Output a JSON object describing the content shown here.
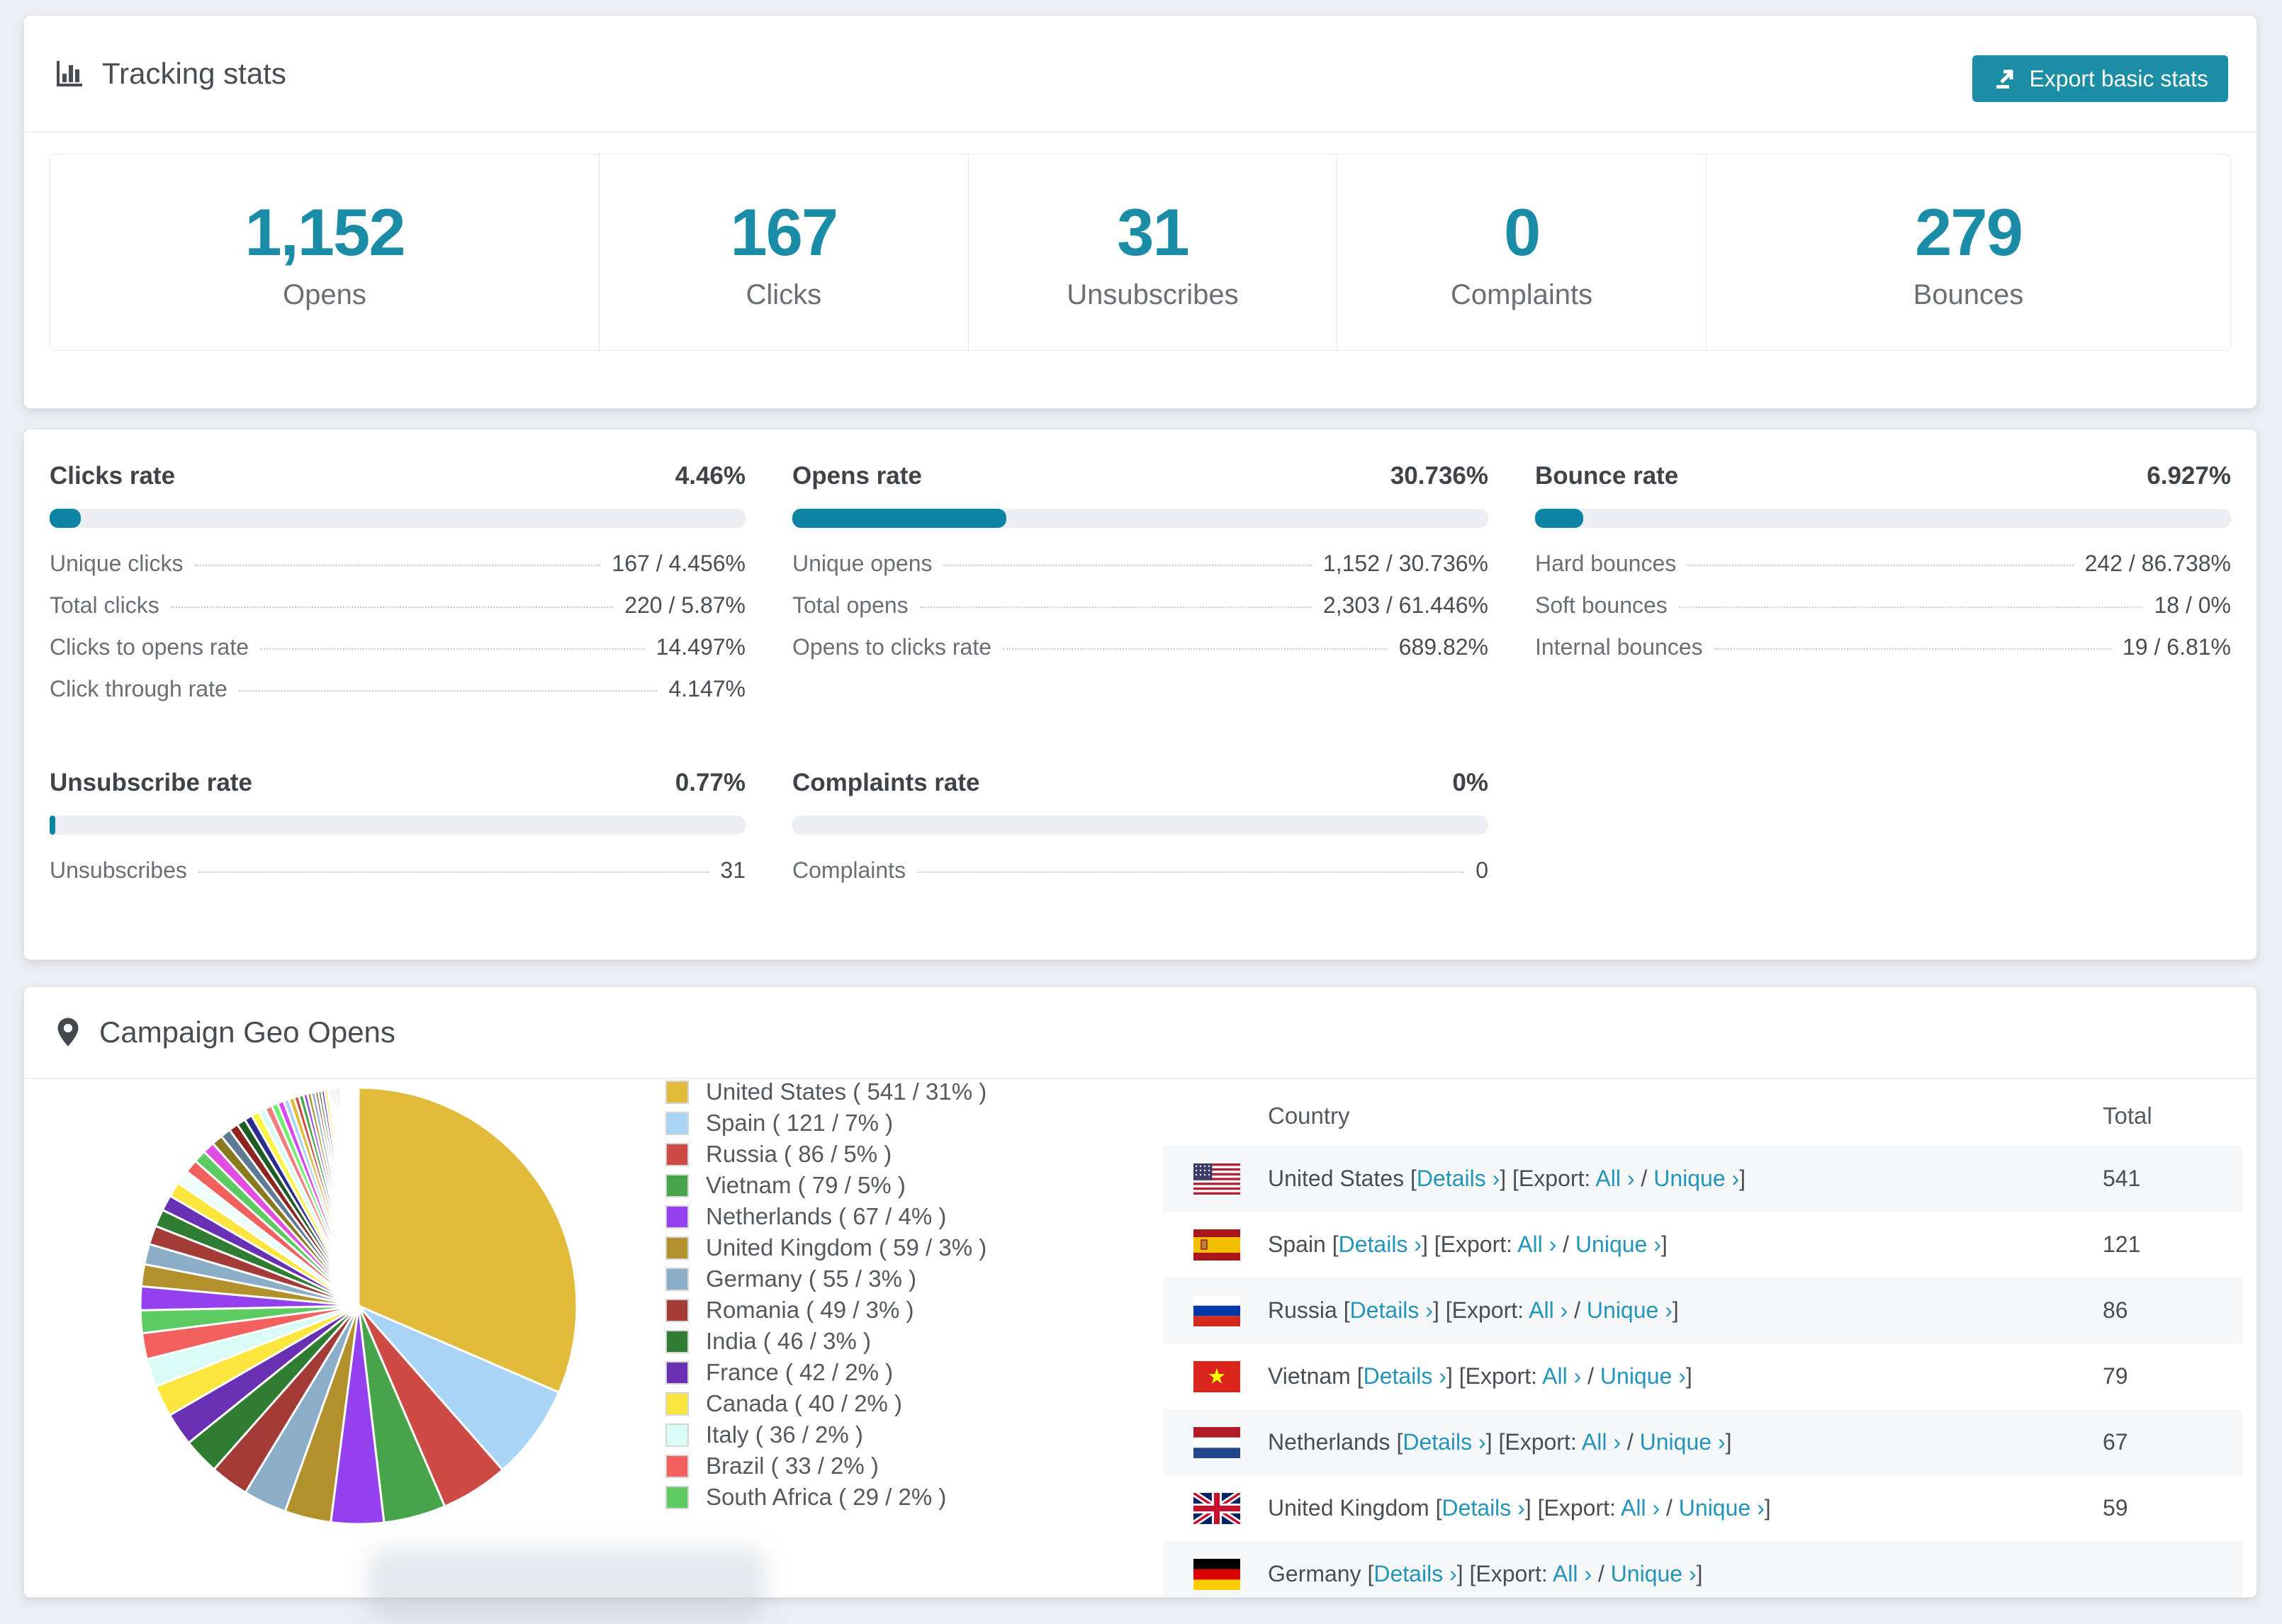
{
  "tracking": {
    "title": "Tracking stats",
    "export_button": "Export basic stats",
    "stats": [
      {
        "value": "1,152",
        "label": "Opens",
        "flex": 776
      },
      {
        "value": "167",
        "label": "Clicks",
        "flex": 521
      },
      {
        "value": "31",
        "label": "Unsubscribes",
        "flex": 521
      },
      {
        "value": "0",
        "label": "Complaints",
        "flex": 521
      },
      {
        "value": "279",
        "label": "Bounces",
        "flex": 741
      }
    ]
  },
  "rates": {
    "row1": [
      {
        "title": "Clicks rate",
        "value": "4.46%",
        "pct": 4.46,
        "rows": [
          [
            "Unique clicks",
            "167 / 4.456%"
          ],
          [
            "Total clicks",
            "220 / 5.87%"
          ],
          [
            "Clicks to opens rate",
            "14.497%"
          ],
          [
            "Click through rate",
            "4.147%"
          ]
        ]
      },
      {
        "title": "Opens rate",
        "value": "30.736%",
        "pct": 30.736,
        "rows": [
          [
            "Unique opens",
            "1,152 / 30.736%"
          ],
          [
            "Total opens",
            "2,303 / 61.446%"
          ],
          [
            "Opens to clicks rate",
            "689.82%"
          ]
        ]
      },
      {
        "title": "Bounce rate",
        "value": "6.927%",
        "pct": 6.927,
        "rows": [
          [
            "Hard bounces",
            "242 / 86.738%"
          ],
          [
            "Soft bounces",
            "18 / 0%"
          ],
          [
            "Internal bounces",
            "19 / 6.81%"
          ]
        ]
      }
    ],
    "row2": [
      {
        "title": "Unsubscribe rate",
        "value": "0.77%",
        "pct": 0.77,
        "rows": [
          [
            "Unsubscribes",
            "31"
          ]
        ]
      },
      {
        "title": "Complaints rate",
        "value": "0%",
        "pct": 0,
        "rows": [
          [
            "Complaints",
            "0"
          ]
        ]
      }
    ]
  },
  "geo": {
    "title": "Campaign Geo Opens",
    "table": {
      "country_header": "Country",
      "total_header": "Total",
      "link_labels": {
        "details": "Details",
        "export": "Export:",
        "all": "All",
        "unique": "Unique",
        "chevron": "›"
      },
      "rows": [
        {
          "flag": "us",
          "country": "United States",
          "total": "541"
        },
        {
          "flag": "es",
          "country": "Spain",
          "total": "121"
        },
        {
          "flag": "ru",
          "country": "Russia",
          "total": "86"
        },
        {
          "flag": "vn",
          "country": "Vietnam",
          "total": "79"
        },
        {
          "flag": "nl",
          "country": "Netherlands",
          "total": "67"
        },
        {
          "flag": "gb",
          "country": "United Kingdom",
          "total": "59"
        },
        {
          "flag": "de",
          "country": "Germany",
          "total": ""
        }
      ]
    }
  },
  "chart_data": {
    "type": "pie",
    "title": "Campaign Geo Opens",
    "start_angle_deg": -90,
    "direction": "clockwise",
    "legend_position": "right",
    "series": [
      {
        "name": "United States",
        "value": 541,
        "pct": "31%",
        "color": "#e3bb3a"
      },
      {
        "name": "Spain",
        "value": 121,
        "pct": "7%",
        "color": "#aad4f5"
      },
      {
        "name": "Russia",
        "value": 86,
        "pct": "5%",
        "color": "#cd4a45"
      },
      {
        "name": "Vietnam",
        "value": 79,
        "pct": "5%",
        "color": "#47a44a"
      },
      {
        "name": "Netherlands",
        "value": 67,
        "pct": "4%",
        "color": "#9340ee"
      },
      {
        "name": "United Kingdom",
        "value": 59,
        "pct": "3%",
        "color": "#b2902b"
      },
      {
        "name": "Germany",
        "value": 55,
        "pct": "3%",
        "color": "#8badc7"
      },
      {
        "name": "Romania",
        "value": 49,
        "pct": "3%",
        "color": "#a33c37"
      },
      {
        "name": "India",
        "value": 46,
        "pct": "3%",
        "color": "#2e7d33"
      },
      {
        "name": "France",
        "value": 42,
        "pct": "2%",
        "color": "#6a30b4"
      },
      {
        "name": "Canada",
        "value": 40,
        "pct": "2%",
        "color": "#fce63e"
      },
      {
        "name": "Italy",
        "value": 36,
        "pct": "2%",
        "color": "#dafbf4"
      },
      {
        "name": "Brazil",
        "value": 33,
        "pct": "2%",
        "color": "#f2615d"
      },
      {
        "name": "South Africa",
        "value": 29,
        "pct": "2%",
        "color": "#5ecb62"
      }
    ],
    "others_estimated": {
      "note": "unlabeled small slices, values estimated",
      "values": [
        30,
        28,
        26,
        24,
        22,
        20,
        19,
        18,
        17,
        16,
        15,
        14,
        13,
        12,
        11,
        10,
        10,
        9,
        9,
        8,
        8,
        7,
        7,
        6,
        6,
        5,
        5,
        5,
        4,
        4,
        4,
        4,
        3,
        3,
        3,
        3,
        3,
        2,
        2,
        2,
        2,
        2,
        2,
        2,
        1,
        1,
        1,
        1,
        1,
        1,
        1,
        1,
        1,
        1
      ],
      "palette": [
        "#9340ee",
        "#b2902b",
        "#8badc7",
        "#a33c37",
        "#2e7d33",
        "#6a30b4",
        "#fce63e",
        "#eefcfa",
        "#f2615d",
        "#5ecb62",
        "#e24fe0",
        "#8a7a1f",
        "#5d7b94",
        "#8e2420",
        "#1e5c26",
        "#2c2c8e",
        "#fdf53f",
        "#dafbf4",
        "#f57c7c",
        "#6ef06e",
        "#d946ef",
        "#aad4f5",
        "#e3bb3a",
        "#cd4a45",
        "#47a44a"
      ]
    }
  },
  "colors": {
    "accent": "#1b8ea6",
    "stat_number": "#1b8ca6",
    "progress_fill": "#0e84a4",
    "link": "#2395ba",
    "page_bg": "#edeff3"
  }
}
